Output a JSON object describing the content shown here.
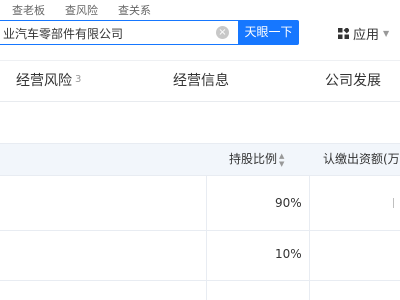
{
  "header": {
    "search_tabs": [
      "查老板",
      "查风险",
      "查关系"
    ],
    "search": {
      "value": "业汽车零部件有限公司",
      "button_label": "天眼一下"
    },
    "apps_menu": {
      "label": "应用"
    }
  },
  "tabs": [
    {
      "label": "经营风险",
      "count": "3"
    },
    {
      "label": "经营信息"
    },
    {
      "label": "公司发展"
    }
  ],
  "table": {
    "columns": [
      "持股比例",
      "认缴出资额(万元)"
    ],
    "rows": [
      {
        "ratio": "90%"
      },
      {
        "ratio": "10%"
      }
    ]
  },
  "colors": {
    "accent": "#1677ff",
    "header_bg": "#f2f6fb",
    "border": "#e8ecf2"
  }
}
